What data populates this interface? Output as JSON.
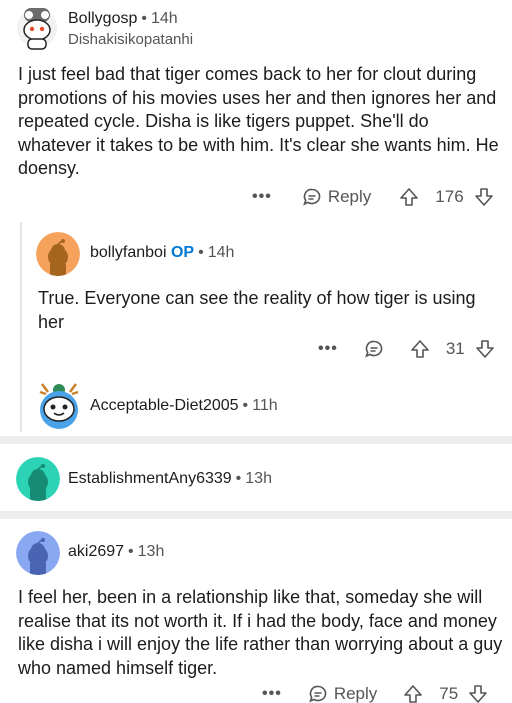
{
  "comments": [
    {
      "username": "Bollygosp",
      "time": "14h",
      "flair": "Dishakisikopatanhi",
      "body": "I just feel bad that tiger comes back to her for clout during promotions of his movies uses her and then ignores her and repeated cycle. Disha is like tigers puppet. She'll do whatever it takes to be with him. It's clear she wants him. He doensy.",
      "more": "•••",
      "reply_label": "Reply",
      "score": "176"
    },
    {
      "username": "bollyfanboi",
      "badge": "OP",
      "time": "14h",
      "body": "True. Everyone can see the reality of how tiger is using her",
      "more": "•••",
      "score": "31"
    },
    {
      "username": "Acceptable-Diet2005",
      "time": "11h"
    },
    {
      "username": "EstablishmentAny6339",
      "time": "13h"
    },
    {
      "username": "aki2697",
      "time": "13h",
      "body": "I feel her, been in a relationship like that, someday she will realise that its not worth it. If i had the body, face and money like disha i will enjoy the life rather than worrying about a guy who named himself tiger.",
      "more": "•••",
      "reply_label": "Reply",
      "score": "75"
    }
  ],
  "separator": "•",
  "colors": {
    "op_badge": "#0079d3",
    "avatar_orange": "#f5a25d",
    "avatar_teal": "#2cd4b5",
    "avatar_blue": "#8aa8f2"
  }
}
